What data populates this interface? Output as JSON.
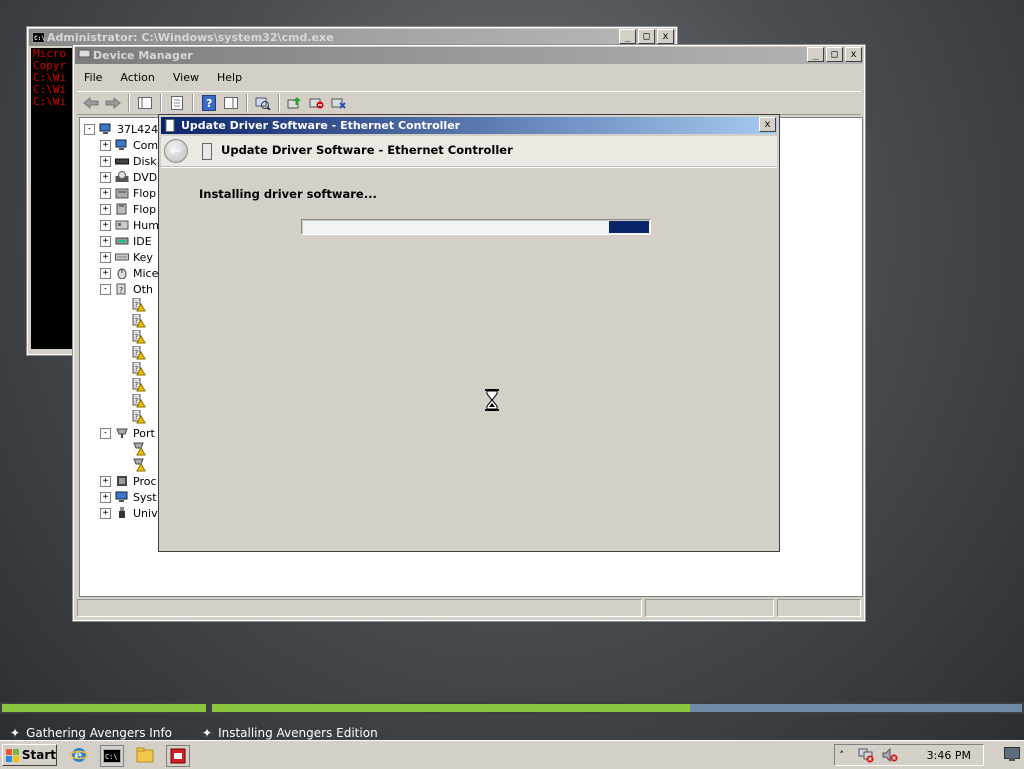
{
  "cmd_window": {
    "title": "Administrator: C:\\Windows\\system32\\cmd.exe",
    "lines": [
      "Micro",
      "Copyr",
      "",
      "C:\\Wi",
      "",
      "C:\\Wi",
      "",
      "C:\\Wi"
    ]
  },
  "device_manager": {
    "title": "Device Manager",
    "menu": [
      "File",
      "Action",
      "View",
      "Help"
    ],
    "toolbar_icons": [
      "back-icon",
      "forward-icon",
      "console-tree-icon",
      "properties-icon",
      "help-icon",
      "action-pane-icon",
      "scan-hardware-icon",
      "update-driver-icon",
      "disable-icon",
      "uninstall-icon"
    ],
    "tree": {
      "root": "37L424",
      "items": [
        {
          "label": "Com",
          "icon": "computer-icon",
          "expander": "+"
        },
        {
          "label": "Disk",
          "icon": "disk-drive-icon",
          "expander": "+"
        },
        {
          "label": "DVD",
          "icon": "dvd-drive-icon",
          "expander": "+"
        },
        {
          "label": "Flop",
          "icon": "floppy-controller-icon",
          "expander": "+"
        },
        {
          "label": "Flop",
          "icon": "floppy-drive-icon",
          "expander": "+"
        },
        {
          "label": "Hum",
          "icon": "hid-icon",
          "expander": "+"
        },
        {
          "label": "IDE",
          "icon": "ide-controller-icon",
          "expander": "+"
        },
        {
          "label": "Key",
          "icon": "keyboard-icon",
          "expander": "+"
        },
        {
          "label": "Mice",
          "icon": "mouse-icon",
          "expander": "+"
        },
        {
          "label": "Oth",
          "icon": "other-devices-icon",
          "expander": "-"
        }
      ],
      "other_children": 8,
      "ports": {
        "label": "Port",
        "icon": "ports-icon",
        "expander": "-",
        "children": 2
      },
      "items_after": [
        {
          "label": "Proc",
          "icon": "processor-icon",
          "expander": "+"
        },
        {
          "label": "Syst",
          "icon": "system-devices-icon",
          "expander": "+"
        },
        {
          "label": "Univ",
          "icon": "usb-controller-icon",
          "expander": "+"
        }
      ]
    }
  },
  "dialog": {
    "title": "Update Driver Software - Ethernet Controller",
    "header_title": "Update Driver Software - Ethernet Controller",
    "status_text": "Installing driver software...",
    "progress_marquee": true
  },
  "setup_progress": {
    "left_label": "Gathering Avengers Info",
    "right_label": "Installing Avengers Edition",
    "left_complete": 1.0,
    "right_complete": 0.59,
    "fill_color": "#8cc63f"
  },
  "taskbar": {
    "start_label": "Start",
    "clock": "3:46 PM",
    "quick_launch": [
      "internet-explorer-icon",
      "cmd-icon",
      "windows-explorer-icon",
      "server-manager-icon"
    ],
    "tray_icons": [
      "show-hidden-icons-chevron",
      "network-error-icon",
      "volume-muted-icon"
    ]
  }
}
